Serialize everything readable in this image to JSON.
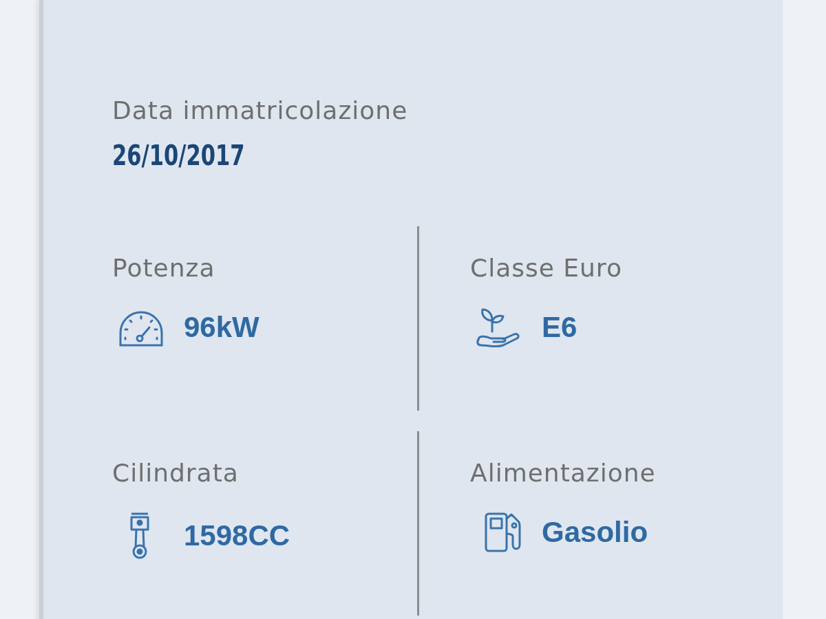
{
  "registration": {
    "label": "Data immatricolazione",
    "value": "26/10/2017"
  },
  "specs": [
    {
      "kind": "power",
      "label": "Potenza",
      "value": "96kW"
    },
    {
      "kind": "euro",
      "label": "Classe Euro",
      "value": "E6"
    },
    {
      "kind": "displacement",
      "label": "Cilindrata",
      "value": "1598CC"
    },
    {
      "kind": "fuel",
      "label": "Alimentazione",
      "value": "Gasolio"
    }
  ]
}
